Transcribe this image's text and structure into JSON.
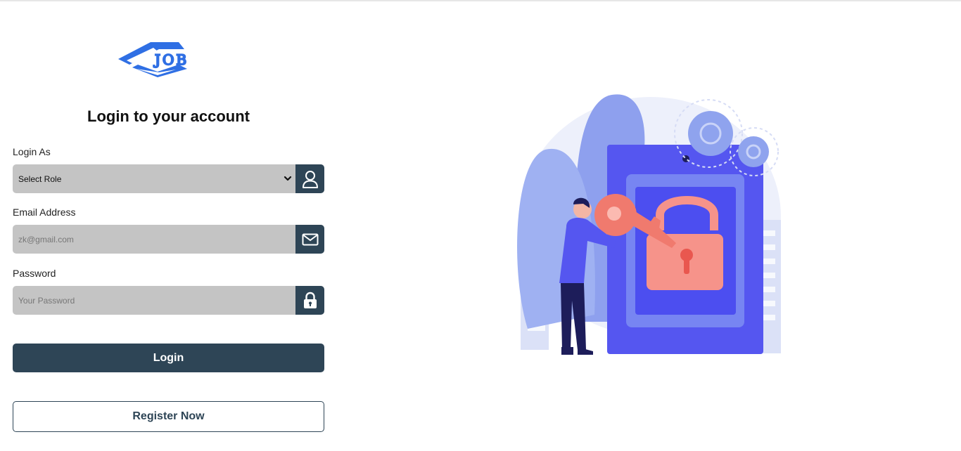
{
  "brand": {
    "logo_text": "JOB"
  },
  "form": {
    "title": "Login to your account",
    "role": {
      "label": "Login As",
      "value": "Select Role",
      "icon": "user-icon"
    },
    "email": {
      "label": "Email Address",
      "placeholder": "zk@gmail.com",
      "icon": "mail-icon"
    },
    "password": {
      "label": "Password",
      "placeholder": "Your Password",
      "icon": "lock-icon"
    },
    "login_label": "Login",
    "register_label": "Register Now"
  },
  "illustration": {
    "subject": "person-holding-key-unlocking-padlock"
  },
  "colors": {
    "primary": "#2e4556",
    "field_bg": "#c4c4c4",
    "logo_blue": "#2f6fe4",
    "illus_indigo": "#5556f0",
    "illus_salmon": "#f6938a"
  }
}
